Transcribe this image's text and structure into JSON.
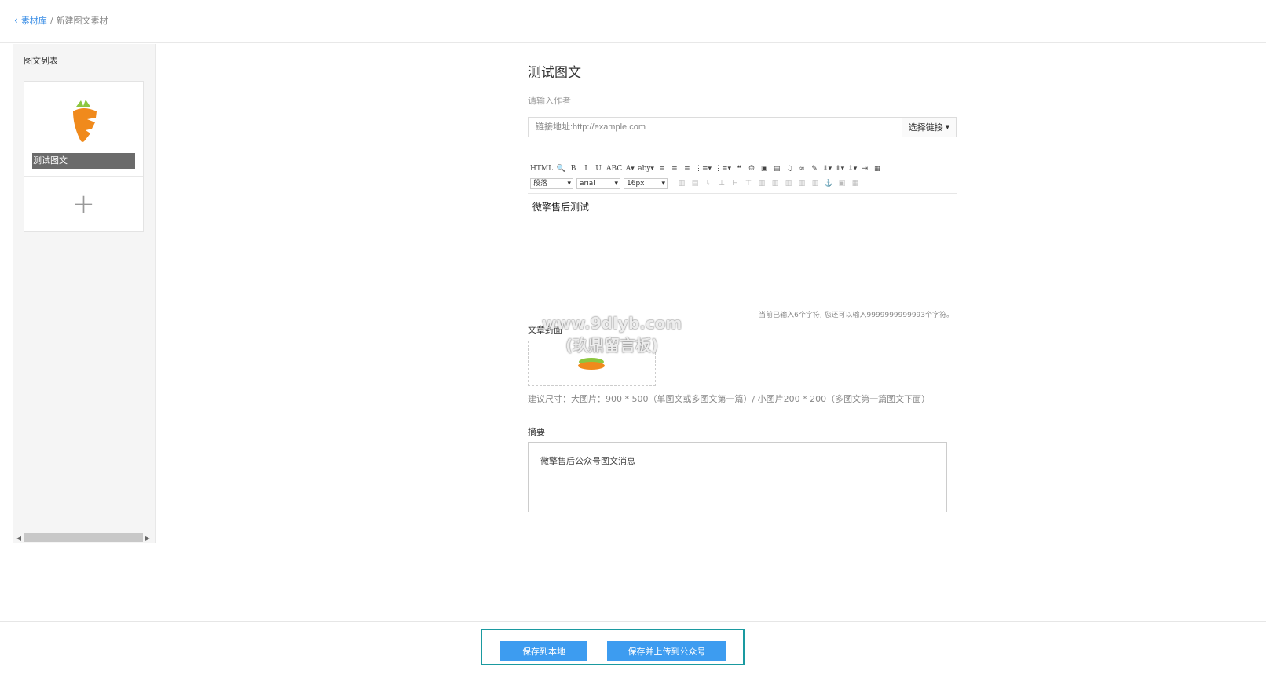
{
  "breadcrumb": {
    "back_icon": "‹",
    "root": "素材库",
    "separator": "/",
    "current": "新建图文素材"
  },
  "sidebar": {
    "title": "图文列表",
    "card": {
      "caption": "测试图文",
      "add_symbol": "+"
    }
  },
  "article": {
    "title": "测试图文",
    "author_placeholder": "请输入作者",
    "link_placeholder": "链接地址:http://example.com",
    "choose_link": "选择链接",
    "editor": {
      "toolbar_row1": [
        "HTML",
        "🔍",
        "B",
        "I",
        "U",
        "ABC",
        "A▾",
        "aby▾",
        "≡",
        "≡",
        "≡",
        "⋮≡▾",
        "⋮≡▾",
        "❝",
        "☺",
        "▣",
        "▤",
        "♫",
        "∞",
        "✎",
        "⇓▾",
        "⇑▾",
        "↕▾",
        "⇥",
        "▦"
      ],
      "toolbar_row2": [
        "▥",
        "▤",
        "↳",
        "⊥",
        "⊢",
        "⊤",
        "▥",
        "▥",
        "▥",
        "▥",
        "▥",
        "⚓",
        "▣",
        "▦"
      ],
      "paragraph": "段落",
      "font": "arial",
      "size": "16px",
      "content": "微擎售后测试",
      "counter": "当前已输入6个字符, 您还可以输入9999999999993个字符。"
    },
    "cover_label": "文章封面",
    "cover_hint": "建议尺寸：大图片：900 * 500（单图文或多图文第一篇）/ 小图片200 * 200（多图文第一篇图文下面）",
    "summary_label": "摘要",
    "summary_value": "微擎售后公众号图文消息"
  },
  "watermark": {
    "line1": "www.9dlyb.com",
    "line2": "(玖鼎留言板)"
  },
  "actions": {
    "save_local": "保存到本地",
    "save_upload": "保存并上传到公众号"
  }
}
